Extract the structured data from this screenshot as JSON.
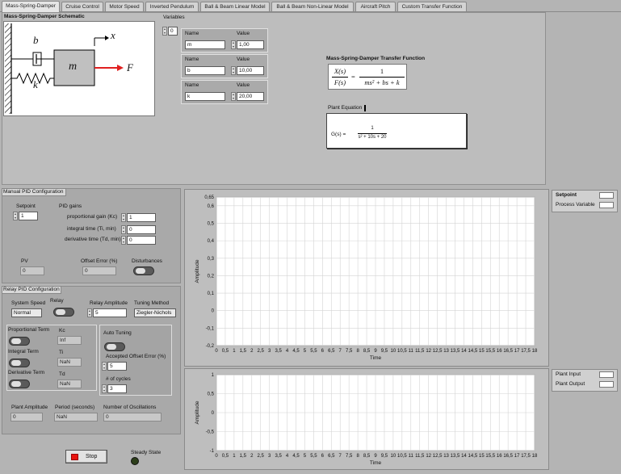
{
  "tabs": [
    {
      "label": "Mass-Spring-Damper",
      "active": true
    },
    {
      "label": "Cruise Control"
    },
    {
      "label": "Motor Speed"
    },
    {
      "label": "Inverted Pendulum"
    },
    {
      "label": "Ball & Beam Linear Model"
    },
    {
      "label": "Ball & Beam Non-Linear Model"
    },
    {
      "label": "Aircraft Pitch"
    },
    {
      "label": "Custom Transfer Function"
    }
  ],
  "schematic": {
    "title": "Mass-Spring-Damper Schematic",
    "b": "b",
    "k": "k",
    "m": "m",
    "x": "x",
    "F": "F"
  },
  "variables": {
    "title": "Variables",
    "index": "0",
    "name_label": "Name",
    "value_label": "Value",
    "items": [
      {
        "name": "m",
        "value": "1,00"
      },
      {
        "name": "b",
        "value": "10,00"
      },
      {
        "name": "k",
        "value": "20,00"
      }
    ]
  },
  "transfer_function": {
    "title": "Mass-Spring-Damper Transfer Function",
    "lhs_num": "X(s)",
    "lhs_den": "F(s)",
    "eq": "=",
    "rhs_num": "1",
    "rhs_den": "ms² + bs + k"
  },
  "plant": {
    "title": "Plant Equation",
    "lhs": "G(s) =",
    "num": "1",
    "den": "s² + 10s + 20"
  },
  "manual_pid": {
    "title": "Manual PID Configuration",
    "setpoint_label": "Setpoint",
    "setpoint": "1",
    "gains_label": "PID gains",
    "kc_label": "proportional gain (Kc)",
    "kc": "1",
    "ti_label": "integral time (Ti, min)",
    "ti": "0",
    "td_label": "derivative time (Td, min)",
    "td": "0",
    "pv_label": "PV",
    "pv": "0",
    "offset_label": "Offset Error (%)",
    "offset": "0",
    "disturbances_label": "Disturbances"
  },
  "relay_pid": {
    "title": "Relay PID Configuration",
    "speed_label": "System Speed",
    "speed": "Normal",
    "relay_label": "Relay",
    "amp_label": "Relay Amplitude",
    "amp": "5",
    "method_label": "Tuning Method",
    "method": "Ziegler-Nichols",
    "prop_label": "Proportional Term",
    "int_label": "Integral Term",
    "der_label": "Derivative Term",
    "kc_label": "Kc",
    "kc": "Inf",
    "ti_label": "Ti",
    "ti": "NaN",
    "td_label": "Td",
    "td": "NaN",
    "auto_label": "Auto Tuning",
    "accepted_label": "Accepted Offset Error (%)",
    "accepted": "5",
    "cycles_label": "# of cycles",
    "cycles": "3",
    "plant_amp_label": "Plant Amplitude",
    "plant_amp": "0",
    "period_label": "Period (seconds)",
    "period": "NaN",
    "osc_label": "Number of Oscillations",
    "osc": "0"
  },
  "controls": {
    "stop_label": "Stop",
    "steady_label": "Steady State"
  },
  "chart_data": [
    {
      "type": "line",
      "xlabel": "Time",
      "ylabel": "Amplitude",
      "xlim": [
        0,
        18
      ],
      "ylim": [
        -0.2,
        0.65
      ],
      "x_ticks": [
        "0",
        "0,5",
        "1",
        "1,5",
        "2",
        "2,5",
        "3",
        "3,5",
        "4",
        "4,5",
        "5",
        "5,5",
        "6",
        "6,5",
        "7",
        "7,5",
        "8",
        "8,5",
        "9",
        "9,5",
        "10",
        "10,5",
        "11",
        "11,5",
        "12",
        "12,5",
        "13",
        "13,5",
        "14",
        "14,5",
        "15",
        "15,5",
        "16",
        "16,5",
        "17",
        "17,5",
        "18"
      ],
      "y_ticks": [
        "0,65",
        "0,6",
        "0,5",
        "0,4",
        "0,3",
        "0,2",
        "0,1",
        "0",
        "-0,1",
        "-0,2"
      ],
      "y_tick_values": [
        0.65,
        0.6,
        0.5,
        0.4,
        0.3,
        0.2,
        0.1,
        0,
        -0.1,
        -0.2
      ],
      "legend": [
        "Setpoint",
        "Process Variable"
      ],
      "grid": true
    },
    {
      "type": "line",
      "xlabel": "Time",
      "ylabel": "Amplitude",
      "xlim": [
        0,
        18
      ],
      "ylim": [
        -1,
        1
      ],
      "x_ticks": [
        "0",
        "0,5",
        "1",
        "1,5",
        "2",
        "2,5",
        "3",
        "3,5",
        "4",
        "4,5",
        "5",
        "5,5",
        "6",
        "6,5",
        "7",
        "7,5",
        "8",
        "8,5",
        "9",
        "9,5",
        "10",
        "10,5",
        "11",
        "11,5",
        "12",
        "12,5",
        "13",
        "13,5",
        "14",
        "14,5",
        "15",
        "15,5",
        "16",
        "16,5",
        "17",
        "17,5",
        "18"
      ],
      "y_ticks": [
        "1",
        "0,5",
        "0",
        "-0,5",
        "-1"
      ],
      "y_tick_values": [
        1,
        0.5,
        0,
        -0.5,
        -1
      ],
      "legend": [
        "Plant Input",
        "Plant Output"
      ],
      "grid": true
    }
  ]
}
